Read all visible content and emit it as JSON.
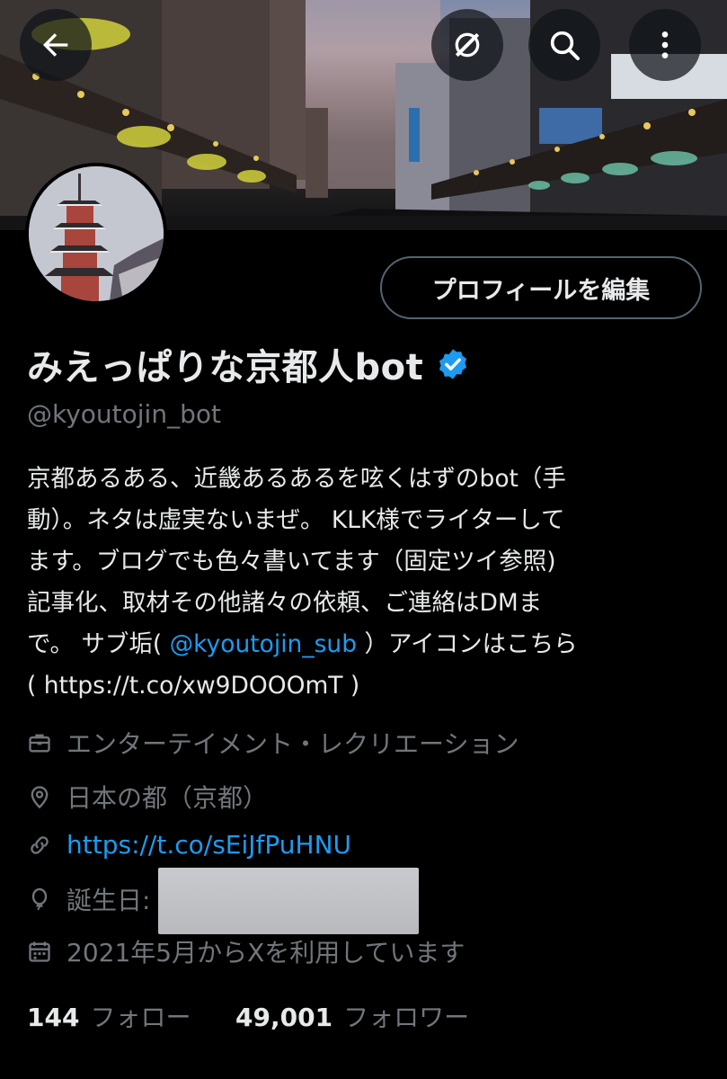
{
  "header": {
    "back_icon": "arrow-left-icon",
    "grok_icon": "grok-icon",
    "search_icon": "search-icon",
    "more_icon": "more-vertical-icon"
  },
  "profile": {
    "edit_button_label": "プロフィールを編集",
    "display_name": "みえっぱりな京都人bot",
    "verified": true,
    "handle": "@kyoutojin_bot",
    "bio": {
      "line1": "京都あるある、近畿あるあるを呟くはずのbot（手",
      "line2": "動）。ネタは虚実ないまぜ。 KLK様でライターして",
      "line3": "ます。ブログでも色々書いてます（固定ツイ参照)",
      "line4": "記事化、取材その他諸々の依頼、ご連絡はDMま",
      "line5_pre": "で。 サブ垢( ",
      "line5_mention": "@kyoutojin_sub",
      "line5_post": " ）アイコンはこちら",
      "line6": "( https://t.co/xw9DOOOmT )"
    },
    "category": "エンターテイメント・レクリエーション",
    "location": "日本の都（京都）",
    "url": "https://t.co/sEiJfPuHNU",
    "birthday_label": "誕生日:",
    "joined": "2021年5月からXを利用しています",
    "following_count": "144",
    "following_label": "フォロー",
    "followers_count": "49,001",
    "followers_label": "フォロワー"
  },
  "colors": {
    "accent": "#1d9bf0",
    "text_primary": "#e7e9ea",
    "text_secondary": "#71767b",
    "background": "#000000"
  }
}
